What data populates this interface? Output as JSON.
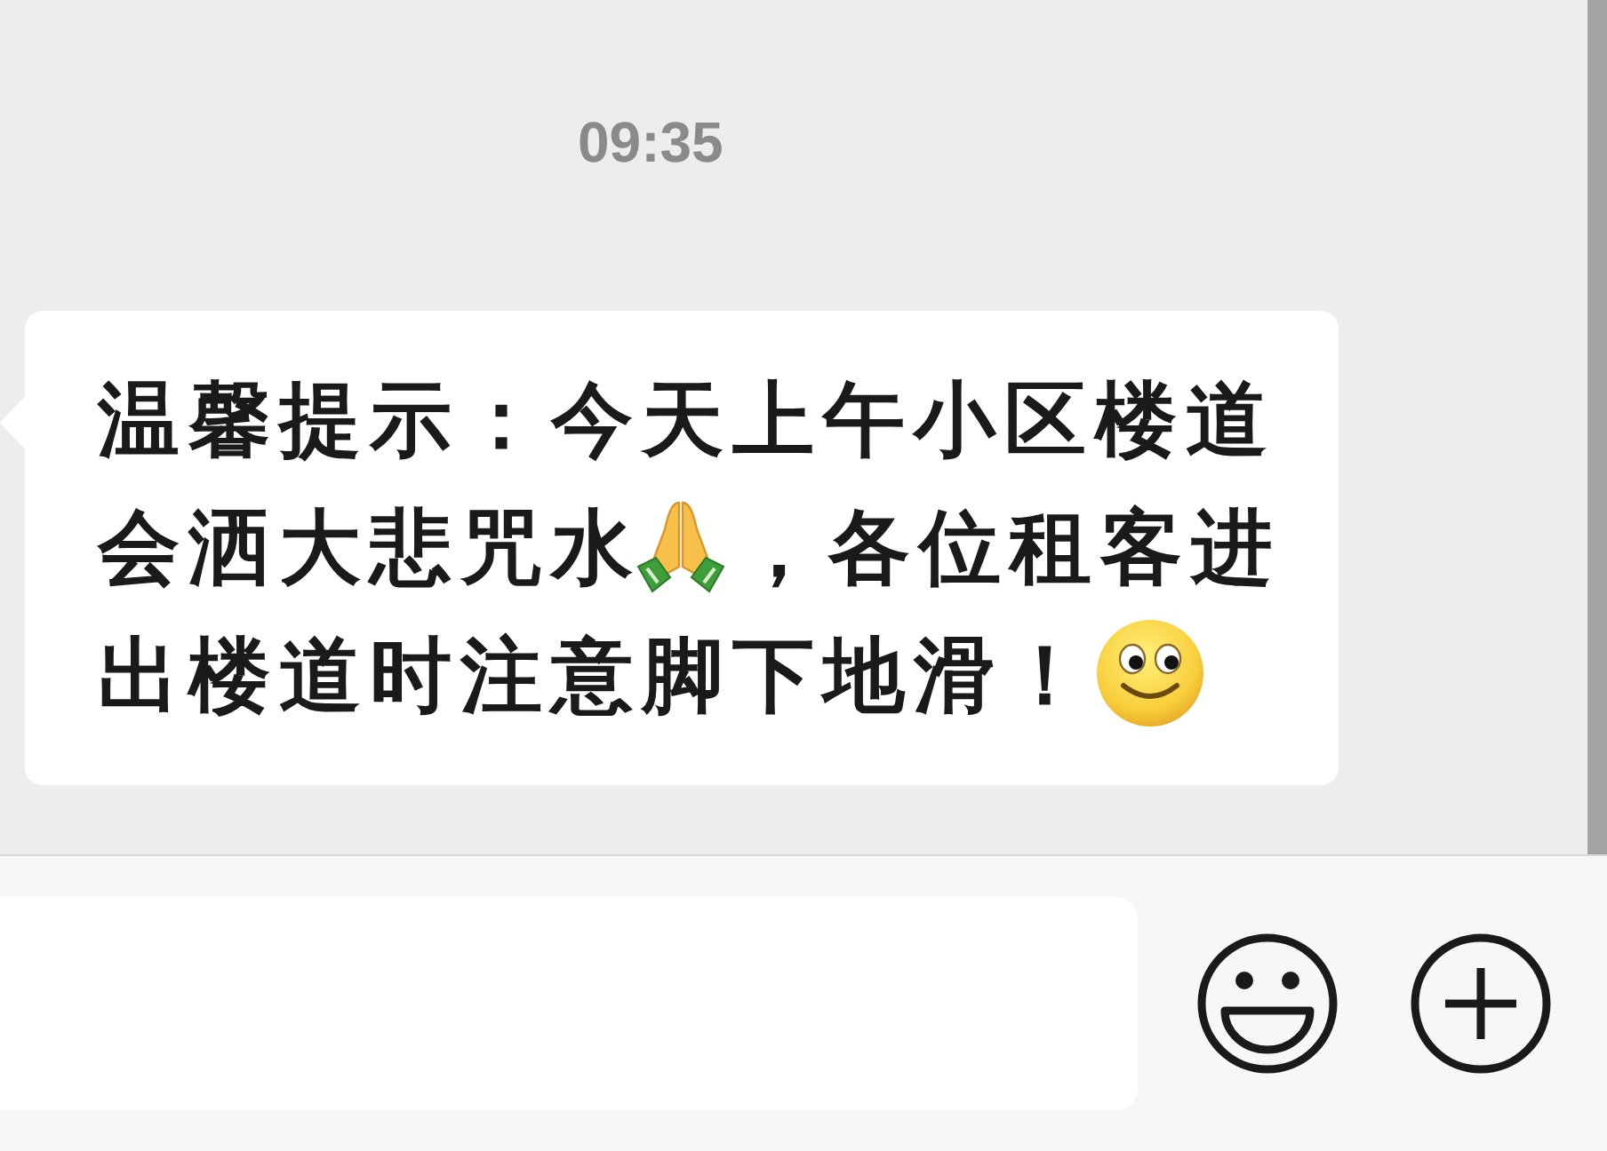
{
  "timestamp": "09:35",
  "message": {
    "parts": [
      {
        "kind": "text",
        "text": "温馨提示：今天上午小区楼道会洒大悲咒水"
      },
      {
        "kind": "hands"
      },
      {
        "kind": "text",
        "text": "，各位租客进出楼道时注意脚下地滑！"
      },
      {
        "kind": "smiley"
      }
    ]
  }
}
